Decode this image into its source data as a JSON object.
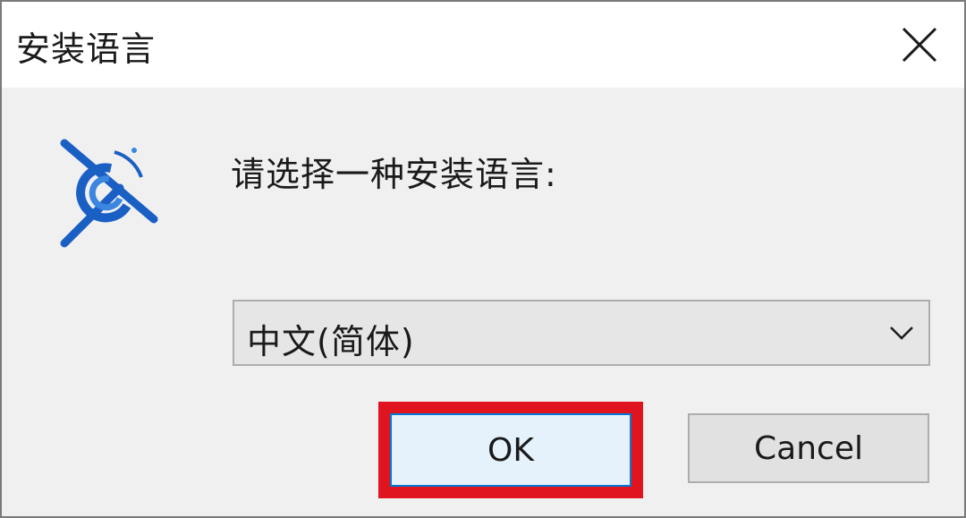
{
  "window": {
    "title": "安装语言",
    "close_icon": "close-icon"
  },
  "dialog": {
    "prompt": "请选择一种安装语言:",
    "app_icon": "app-logo-icon",
    "language_select": {
      "selected": "中文(简体)",
      "arrow_icon": "chevron-down-icon"
    },
    "ok_label": "OK",
    "cancel_label": "Cancel"
  },
  "colors": {
    "highlight": "#e0141e",
    "accent": "#0078d7",
    "icon_blue": "#1a5fc4"
  }
}
